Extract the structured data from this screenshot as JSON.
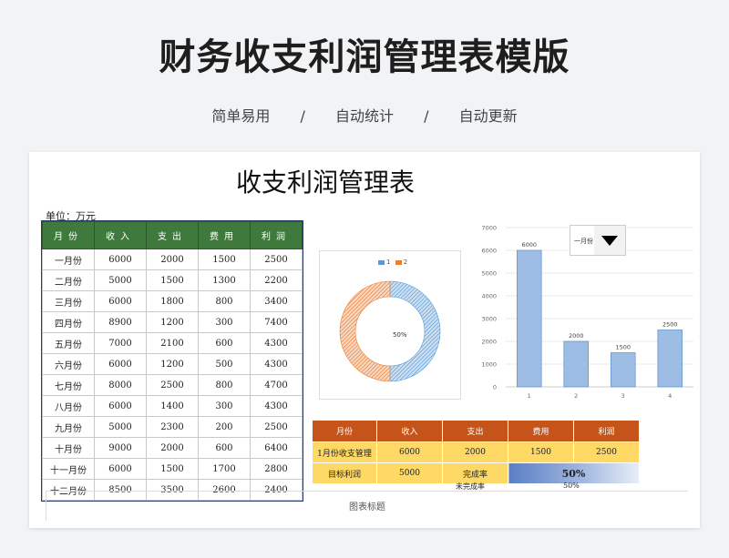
{
  "header": {
    "title": "财务收支利润管理表模版",
    "tags": [
      "简单易用",
      "自动统计",
      "自动更新"
    ],
    "separator": "/"
  },
  "sheet": {
    "title": "收支利润管理表",
    "unit": "单位：万元",
    "columns": [
      "月份",
      "收入",
      "支出",
      "费用",
      "利润"
    ],
    "rows": [
      [
        "一月份",
        "6000",
        "2000",
        "1500",
        "2500"
      ],
      [
        "二月份",
        "5000",
        "1500",
        "1300",
        "2200"
      ],
      [
        "三月份",
        "6000",
        "1800",
        "800",
        "3400"
      ],
      [
        "四月份",
        "8900",
        "1200",
        "300",
        "7400"
      ],
      [
        "五月份",
        "7000",
        "2100",
        "600",
        "4300"
      ],
      [
        "六月份",
        "6000",
        "1200",
        "500",
        "4300"
      ],
      [
        "七月份",
        "8000",
        "2500",
        "800",
        "4700"
      ],
      [
        "八月份",
        "6000",
        "1400",
        "300",
        "4300"
      ],
      [
        "九月份",
        "5000",
        "2300",
        "200",
        "2500"
      ],
      [
        "十月份",
        "9000",
        "2000",
        "600",
        "6400"
      ],
      [
        "十一月份",
        "6000",
        "1500",
        "1700",
        "2800"
      ],
      [
        "十二月份",
        "8500",
        "3500",
        "2600",
        "2400"
      ]
    ]
  },
  "dropdown": {
    "value": "一月份"
  },
  "summary": {
    "headers": [
      "月份",
      "收入",
      "支出",
      "费用",
      "利润"
    ],
    "row1": [
      "1月份收支管理",
      "6000",
      "2000",
      "1500",
      "2500"
    ],
    "row2": {
      "label": "目标利润",
      "target": "5000",
      "rate_label": "完成率",
      "rate_value": "50%"
    },
    "row3": {
      "label": "未完成率",
      "value": "50%"
    }
  },
  "chart_title": "图表标题",
  "colors": {
    "green": "#3f7a3c",
    "orange": "#c5541a",
    "yellow": "#ffd966",
    "blue": "#5b9bd5",
    "peach": "#ed7d31"
  },
  "chart_data": [
    {
      "type": "pie",
      "legend": [
        "1",
        "2"
      ],
      "values": [
        50,
        50
      ],
      "data_label": "50%"
    },
    {
      "type": "bar",
      "categories": [
        "1",
        "2",
        "3",
        "4"
      ],
      "values": [
        6000,
        2000,
        1500,
        2500
      ],
      "ylim": [
        0,
        7000
      ],
      "yticks": [
        0,
        1000,
        2000,
        3000,
        4000,
        5000,
        6000,
        7000
      ],
      "grid": true
    }
  ]
}
